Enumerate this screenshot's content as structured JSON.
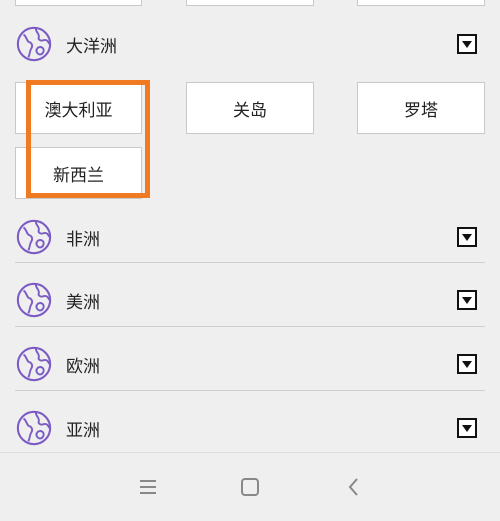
{
  "top_cards_clipped": [
    "",
    "",
    ""
  ],
  "oceania": {
    "label": "大洋洲",
    "countries": [
      "澳大利亚",
      "关岛",
      "罗塔",
      "新西兰"
    ]
  },
  "regions": [
    {
      "label": "非洲"
    },
    {
      "label": "美洲"
    },
    {
      "label": "欧洲"
    },
    {
      "label": "亚洲"
    }
  ],
  "icons": {
    "region": "globe-icon",
    "expand": "dropdown-toggle-icon",
    "nav_menu": "menu-icon",
    "nav_home": "home-icon",
    "nav_back": "back-icon"
  },
  "colors": {
    "globe": "#7b5bc4",
    "highlight": "#f07a21"
  }
}
